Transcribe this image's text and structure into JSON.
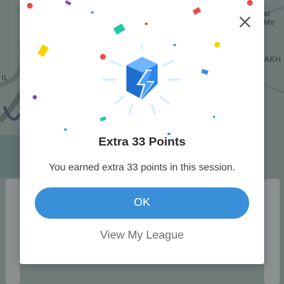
{
  "background": {
    "map_label_right_top": "al Me",
    "map_label_right": "AKH",
    "map_label_left": "IL"
  },
  "dialog": {
    "title": "Extra 33 Points",
    "message": "You earned extra 33 points in this session.",
    "primary_button_label": "OK",
    "secondary_link_label": "View My League",
    "close_icon": "close-icon",
    "hero_icon": "lightning-bolt-cube-icon"
  },
  "colors": {
    "primary": "#3a8fd9",
    "title": "#2b2b2b",
    "link": "#6d6d6d",
    "hero_blue": "#2f7fdf"
  }
}
